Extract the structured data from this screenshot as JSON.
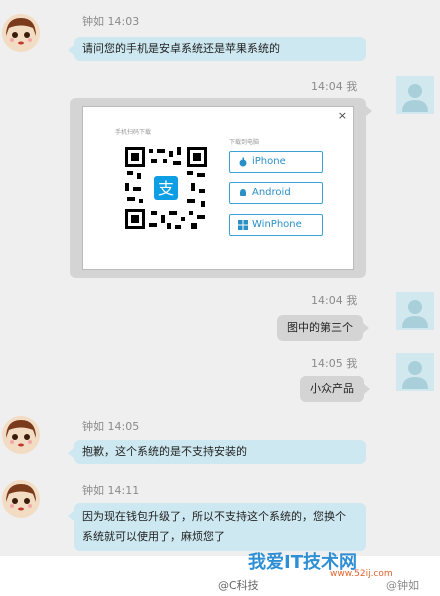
{
  "colors": {
    "left_bubble": "#cde8f0",
    "right_bubble": "#d4d4d4",
    "background": "#efefef",
    "accent": "#2a8fc6"
  },
  "messages": [
    {
      "side": "left",
      "sender": "钟如",
      "time": "14:03",
      "text": "请问您的手机是安卓系统还是苹果系统的"
    },
    {
      "side": "right",
      "sender": "我",
      "time": "14:04",
      "type": "image",
      "image": {
        "left_label": "手机扫码下载",
        "right_label": "下载到电脑",
        "close": "×",
        "buttons": [
          {
            "label": "iPhone",
            "icon": "apple-icon"
          },
          {
            "label": "Android",
            "icon": "android-icon"
          },
          {
            "label": "WinPhone",
            "icon": "windows-icon"
          }
        ]
      }
    },
    {
      "side": "right",
      "sender": "我",
      "time": "14:04",
      "text": "图中的第三个"
    },
    {
      "side": "right",
      "sender": "我",
      "time": "14:05",
      "text": "小众产品"
    },
    {
      "side": "left",
      "sender": "钟如",
      "time": "14:05",
      "text": "抱歉，这个系统的是不支持安装的"
    },
    {
      "side": "left",
      "sender": "钟如",
      "time": "14:11",
      "text_line1": "因为现在钱包升级了，所以不支持这个系统的，您换个",
      "text_line2": "系统就可以使用了，麻烦您了"
    }
  ],
  "watermark": {
    "brand": "我爱IT技术网",
    "url": "www.52ij.com",
    "weibo1": "@C科技",
    "weibo2": "@钟如"
  }
}
